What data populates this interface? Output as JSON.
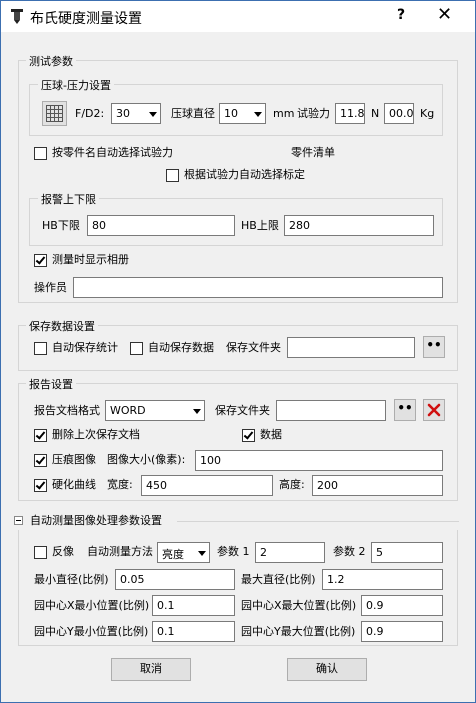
{
  "window": {
    "title": "布氏硬度测量设置",
    "help": "?",
    "close": "✕"
  },
  "test_params": {
    "legend": "测试参数",
    "ball_force": {
      "legend": "压球-压力设置",
      "fd2_label": "F/D2:",
      "fd2_value": "30",
      "ball_diameter_label": "压球直径",
      "ball_diameter_value": "10",
      "mm_label": "mm",
      "test_force_label": "试验力",
      "test_force_n": "11.8",
      "n_label": "N",
      "test_force_kg": "00.0",
      "kg_label": "Kg"
    },
    "auto_force_by_part": "按零件名自动选择试验力",
    "part_list_label": "零件清单",
    "auto_calibration_by_force": "根据试验力自动选择标定",
    "alarm": {
      "legend": "报警上下限",
      "hb_lower_label": "HB下限",
      "hb_lower_value": "80",
      "hb_upper_label": "HB上限",
      "hb_upper_value": "280"
    },
    "show_album_label": "测量时显示相册",
    "show_album_checked": true,
    "operator_label": "操作员",
    "operator_value": ""
  },
  "save_settings": {
    "legend": "保存数据设置",
    "auto_save_stats": "自动保存统计",
    "auto_save_data": "自动保存数据",
    "folder_label": "保存文件夹",
    "folder_value": "",
    "browse": "••"
  },
  "report_settings": {
    "legend": "报告设置",
    "format_label": "报告文档格式",
    "format_value": "WORD",
    "folder_label": "保存文件夹",
    "folder_value": "",
    "browse": "••",
    "delete_last_label": "删除上次保存文档",
    "delete_last_checked": true,
    "data_label": "数据",
    "data_checked": true,
    "indent_image_label": "压痕图像",
    "indent_image_checked": true,
    "image_size_label": "图像大小(像素):",
    "image_size_value": "100",
    "hardness_curve_label": "硬化曲线",
    "hardness_curve_checked": true,
    "width_label": "宽度:",
    "width_value": "450",
    "height_label": "高度:",
    "height_value": "200"
  },
  "auto_measure": {
    "legend": "自动测量图像处理参数设置",
    "invert_label": "反像",
    "method_label": "自动测量方法",
    "method_value": "亮度",
    "param1_label": "参数 1",
    "param1_value": "2",
    "param2_label": "参数 2",
    "param2_value": "5",
    "min_diameter_label": "最小直径(比例)",
    "min_diameter_value": "0.05",
    "max_diameter_label": "最大直径(比例)",
    "max_diameter_value": "1.2",
    "cx_min_label": "园中心X最小位置(比例)",
    "cx_min_value": "0.1",
    "cx_max_label": "园中心X最大位置(比例)",
    "cx_max_value": "0.9",
    "cy_min_label": "园中心Y最小位置(比例)",
    "cy_min_value": "0.1",
    "cy_max_label": "园中心Y最大位置(比例)",
    "cy_max_value": "0.9"
  },
  "buttons": {
    "cancel": "取消",
    "ok": "确认"
  },
  "colors": {
    "accent": "#3c6fb0",
    "delete_red": "#d01010"
  },
  "icons": {
    "grid": "grid-icon",
    "delete": "red-x-icon"
  }
}
